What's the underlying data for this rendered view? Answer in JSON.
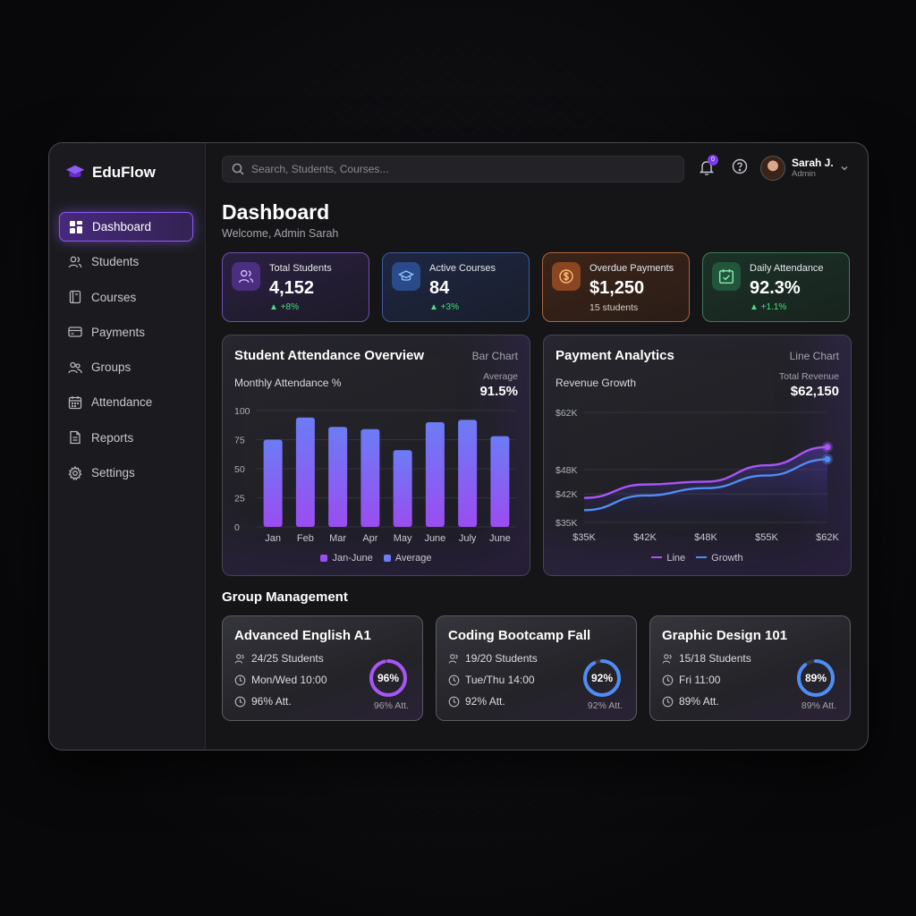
{
  "brand": {
    "name": "EduFlow"
  },
  "sidebar": {
    "items": [
      {
        "label": "Dashboard",
        "icon": "dashboard-icon",
        "active": true
      },
      {
        "label": "Students",
        "icon": "users-icon"
      },
      {
        "label": "Courses",
        "icon": "book-icon"
      },
      {
        "label": "Payments",
        "icon": "card-icon"
      },
      {
        "label": "Groups",
        "icon": "group-icon"
      },
      {
        "label": "Attendance",
        "icon": "calendar-icon"
      },
      {
        "label": "Reports",
        "icon": "document-icon"
      },
      {
        "label": "Settings",
        "icon": "gear-icon"
      }
    ]
  },
  "search": {
    "placeholder": "Search, Students, Courses..."
  },
  "notifications": {
    "count": "0"
  },
  "user": {
    "name": "Sarah J.",
    "role": "Admin"
  },
  "header": {
    "title": "Dashboard",
    "subtitle": "Welcome, Admin Sarah"
  },
  "stats": [
    {
      "label": "Total Students",
      "value": "4,152",
      "delta": "+8%",
      "icon": "users-icon"
    },
    {
      "label": "Active Courses",
      "value": "84",
      "delta": "+3%",
      "icon": "graduation-cap-icon"
    },
    {
      "label": "Overdue Payments",
      "value": "$1,250",
      "note": "15 students",
      "icon": "dollar-icon"
    },
    {
      "label": "Daily Attendance",
      "value": "92.3%",
      "delta": "+1.1%",
      "icon": "calendar-check-icon"
    }
  ],
  "attendance_card": {
    "title": "Student Attendance Overview",
    "type_label": "Bar Chart",
    "subtitle": "Monthly Attendance %",
    "avg_label": "Average",
    "avg_value": "91.5%",
    "legend": [
      "Jan-June",
      "Average"
    ]
  },
  "payment_card": {
    "title": "Payment Analytics",
    "type_label": "Line Chart",
    "subtitle": "Revenue Growth",
    "total_label": "Total Revenue",
    "total_value": "$62,150",
    "legend": [
      "Line",
      "Growth"
    ]
  },
  "chart_data": [
    {
      "type": "bar",
      "categories": [
        "Jan",
        "Feb",
        "Mar",
        "Apr",
        "May",
        "June",
        "July",
        "June"
      ],
      "values": [
        75,
        94,
        86,
        84,
        66,
        90,
        92,
        78
      ],
      "ylim": [
        0,
        100
      ],
      "yticks": [
        0,
        25,
        50,
        75,
        100
      ],
      "legend": [
        "Jan-June",
        "Average"
      ],
      "colors": {
        "top": "#6c7cf5",
        "bottom": "#9a4df0"
      }
    },
    {
      "type": "line",
      "x": [
        "$35K",
        "$42K",
        "$48K",
        "$55K",
        "$62K"
      ],
      "yticks": [
        "$35K",
        "$42K",
        "$48K",
        "$62K"
      ],
      "ylim": [
        35,
        62
      ],
      "series": [
        {
          "name": "Line",
          "color": "#a855f7",
          "values": [
            41,
            44.3,
            45,
            49,
            53.5
          ]
        },
        {
          "name": "Growth",
          "color": "#4f8df5",
          "values": [
            38,
            41.6,
            43.4,
            46.5,
            50.5
          ]
        }
      ]
    }
  ],
  "groups_section": {
    "title": "Group Management"
  },
  "groups": [
    {
      "title": "Advanced English A1",
      "students": "24/25 Students",
      "schedule": "Mon/Wed 10:00",
      "attendance": "96% Att.",
      "ring_value": "96%",
      "ring_caption": "96% Att.",
      "percent": 96,
      "color": "#a855f7"
    },
    {
      "title": "Coding Bootcamp Fall",
      "students": "19/20 Students",
      "schedule": "Tue/Thu 14:00",
      "attendance": "92% Att.",
      "ring_value": "92%",
      "ring_caption": "92% Att.",
      "percent": 92,
      "color": "#4f8df5"
    },
    {
      "title": "Graphic Design 101",
      "students": "15/18 Students",
      "schedule": "Fri 11:00",
      "attendance": "89% Att.",
      "ring_value": "89%",
      "ring_caption": "89% Att.",
      "percent": 89,
      "color": "#4f8df5"
    }
  ]
}
